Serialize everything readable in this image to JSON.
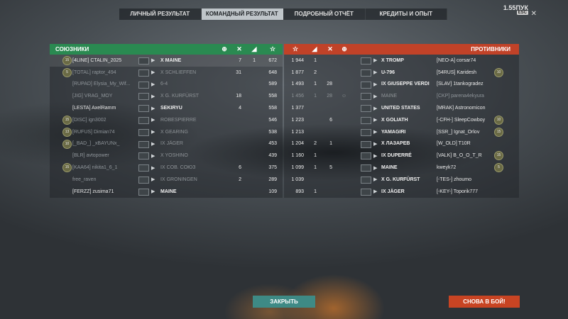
{
  "version": "1.55ПУК",
  "esc_label": "ESC",
  "tabs": [
    "ЛИЧНЫЙ РЕЗУЛЬТАТ",
    "КОМАНДНЫЙ РЕЗУЛЬТАТ",
    "ПОДРОБНЫЙ ОТЧЁТ",
    "КРЕДИТЫ И ОПЫТ"
  ],
  "active_tab": 1,
  "allies_title": "СОЮЗНИКИ",
  "enemies_title": "ПРОТИВНИКИ",
  "allies": [
    {
      "badge": "15",
      "clan": "[4LINE]",
      "name": "CTALIN_2025",
      "tier": "X",
      "ship": "MAINE",
      "kills": "7",
      "caps": "1",
      "xp": "672",
      "dim": false,
      "highlight": true
    },
    {
      "badge": "5",
      "clan": "[TOTAL]",
      "name": "raptor_494",
      "tier": "X",
      "ship": "SCHLIEFFEN",
      "kills": "31",
      "caps": "",
      "xp": "648",
      "dim": true
    },
    {
      "badge": "",
      "clan": "[RUPAD]",
      "name": "Elysia_My_Wif...",
      "tier": "",
      "ship": "6-4",
      "kills": "",
      "caps": "",
      "xp": "589",
      "dim": true
    },
    {
      "badge": "",
      "clan": "[JIG]",
      "name": "VRAG_MOY",
      "tier": "X",
      "ship": "G. KURFÜRST",
      "kills": "18",
      "caps": "",
      "xp": "558",
      "dim": true
    },
    {
      "badge": "",
      "clan": "[LESTA]",
      "name": "AxelRamm",
      "tier": "",
      "ship": "SEKIRYU",
      "kills": "4",
      "caps": "",
      "xp": "558",
      "dim": false
    },
    {
      "badge": "15",
      "clan": "[DISC]",
      "name": "ign3002",
      "tier": "",
      "ship": "ROBESPIERRE",
      "kills": "",
      "caps": "",
      "xp": "546",
      "dim": true
    },
    {
      "badge": "13",
      "clan": "[RUFUS]",
      "name": "Dimian74",
      "tier": "X",
      "ship": "GEARING",
      "kills": "",
      "caps": "",
      "xp": "538",
      "dim": true
    },
    {
      "badge": "10",
      "clan": "[_BAD_]",
      "name": "_xBAYUNx_",
      "tier": "IX",
      "ship": "JÄGER",
      "kills": "",
      "caps": "",
      "xp": "453",
      "dim": true
    },
    {
      "badge": "",
      "clan": "[BLR]",
      "name": "avtopower",
      "tier": "X",
      "ship": "YOSHINO",
      "kills": "",
      "caps": "",
      "xp": "439",
      "dim": true
    },
    {
      "badge": "15",
      "clan": "[KAA64]",
      "name": "nikita1_6_1",
      "tier": "IX",
      "ship": "COB. COЮЗ",
      "kills": "6",
      "caps": "",
      "xp": "375",
      "dim": true
    },
    {
      "badge": "",
      "clan": "",
      "name": "free_raven",
      "tier": "IX",
      "ship": "GRONINGEN",
      "kills": "2",
      "caps": "",
      "xp": "289",
      "dim": true
    },
    {
      "badge": "",
      "clan": "[FERZZ]",
      "name": "zusima71",
      "tier": "",
      "ship": "MAINE",
      "kills": "",
      "caps": "",
      "xp": "109",
      "dim": false
    }
  ],
  "enemies": [
    {
      "xp": "1 944",
      "kills": "1",
      "planes": "",
      "caps": "",
      "tier": "X",
      "ship": "TROMP",
      "clan": "[NEO-A]",
      "name": "corsar74",
      "badge": "",
      "dead": false
    },
    {
      "xp": "1 877",
      "kills": "2",
      "planes": "",
      "caps": "",
      "tier": "",
      "ship": "U-796",
      "clan": "[54RUS]",
      "name": "Karidesh",
      "badge": "10",
      "dead": false
    },
    {
      "xp": "1 493",
      "kills": "1",
      "planes": "28",
      "caps": "",
      "tier": "IX",
      "ship": "GIUSEPPE VERDI",
      "clan": "[SLAV]",
      "name": "1tankogradez",
      "badge": "",
      "dead": false
    },
    {
      "xp": "1 456",
      "kills": "1",
      "planes": "28",
      "caps": "☺",
      "tier": "",
      "ship": "MAINE",
      "clan": "[CKP]",
      "name": "parena4ekyura",
      "badge": "",
      "dead": true
    },
    {
      "xp": "1 377",
      "kills": "",
      "planes": "",
      "caps": "",
      "tier": "",
      "ship": "UNITED STATES",
      "clan": "[MRAK]",
      "name": "Astronomicon",
      "badge": "",
      "dead": false
    },
    {
      "xp": "1 223",
      "kills": "",
      "planes": "6",
      "caps": "",
      "tier": "X",
      "ship": "GOLIATH",
      "clan": "[-CFH-]",
      "name": "SleepCowboy",
      "badge": "10",
      "dead": false
    },
    {
      "xp": "1 213",
      "kills": "",
      "planes": "",
      "caps": "",
      "tier": "",
      "ship": "YAMAGIRI",
      "clan": "[SSR_]",
      "name": "Ignat_Orlov",
      "badge": "15",
      "dead": false
    },
    {
      "xp": "1 204",
      "kills": "2",
      "planes": "1",
      "caps": "",
      "tier": "X",
      "ship": "ЛАЗАРЕВ",
      "clan": "[W_OLD]",
      "name": "T10R",
      "badge": "",
      "dead": false
    },
    {
      "xp": "1 160",
      "kills": "1",
      "planes": "",
      "caps": "",
      "tier": "IX",
      "ship": "DUPERRÉ",
      "clan": "[VALK]",
      "name": "B_O_O_T_R",
      "badge": "15",
      "dead": false
    },
    {
      "xp": "1 099",
      "kills": "1",
      "planes": "5",
      "caps": "",
      "tier": "",
      "ship": "MAINE",
      "clan": "",
      "name": "kweyk72",
      "badge": "5",
      "dead": false
    },
    {
      "xp": "1 039",
      "kills": "",
      "planes": "",
      "caps": "",
      "tier": "X",
      "ship": "G. KURFÜRST",
      "clan": "[-TES-]",
      "name": "zhoumo",
      "badge": "",
      "dead": false
    },
    {
      "xp": "893",
      "kills": "1",
      "planes": "",
      "caps": "",
      "tier": "IX",
      "ship": "JÄGER",
      "clan": "[-KEY-]",
      "name": "Toporik777",
      "badge": "",
      "dead": false
    }
  ],
  "buttons": {
    "close": "ЗАКРЫТЬ",
    "again": "СНОВА В БОЙ!"
  },
  "colors": {
    "ally_header": "#2a8a51",
    "enemy_header": "#c14228",
    "close_button": "#3e8a85",
    "again_button": "#c84423"
  }
}
